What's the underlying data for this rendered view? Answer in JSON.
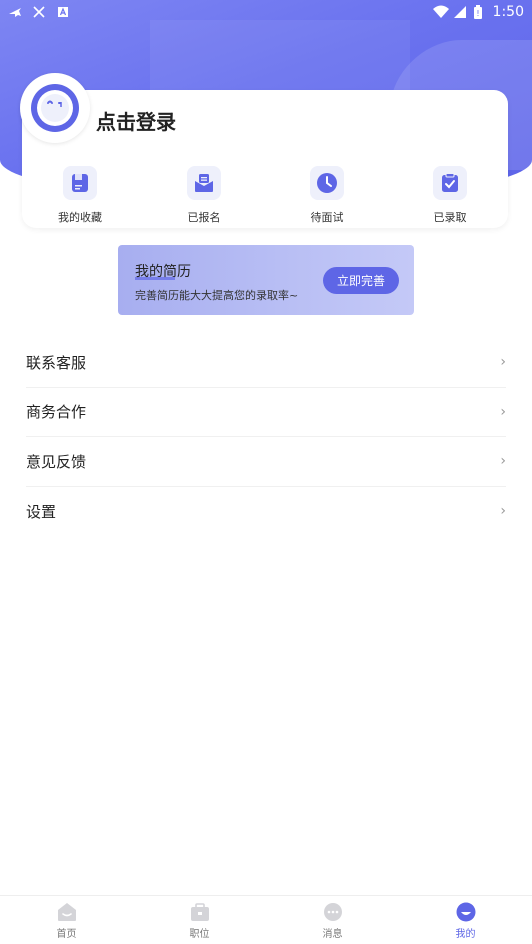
{
  "status_bar": {
    "time": "1:50",
    "left_icons": [
      "airplane-icon",
      "close-icon",
      "a-icon"
    ],
    "right_icons": [
      "wifi-icon",
      "signal-icon",
      "battery-icon"
    ]
  },
  "profile": {
    "login_text": "点击登录"
  },
  "quick_actions": [
    {
      "label": "我的收藏",
      "icon": "bookmark-icon"
    },
    {
      "label": "已报名",
      "icon": "envelope-icon"
    },
    {
      "label": "待面试",
      "icon": "clock-icon"
    },
    {
      "label": "已录取",
      "icon": "checklist-icon"
    }
  ],
  "resume_banner": {
    "title": "我的简历",
    "subtitle": "完善简历能大大提高您的录取率~",
    "button": "立即完善"
  },
  "menu": [
    {
      "label": "联系客服"
    },
    {
      "label": "商务合作"
    },
    {
      "label": "意见反馈"
    },
    {
      "label": "设置"
    }
  ],
  "tabs": [
    {
      "label": "首页",
      "icon": "home-icon",
      "active": false
    },
    {
      "label": "职位",
      "icon": "briefcase-icon",
      "active": false
    },
    {
      "label": "消息",
      "icon": "chat-icon",
      "active": false
    },
    {
      "label": "我的",
      "icon": "profile-icon",
      "active": true
    }
  ],
  "colors": {
    "accent": "#5e66e6",
    "hero": "#6a72ef",
    "icon_bg": "#eef0fb"
  }
}
